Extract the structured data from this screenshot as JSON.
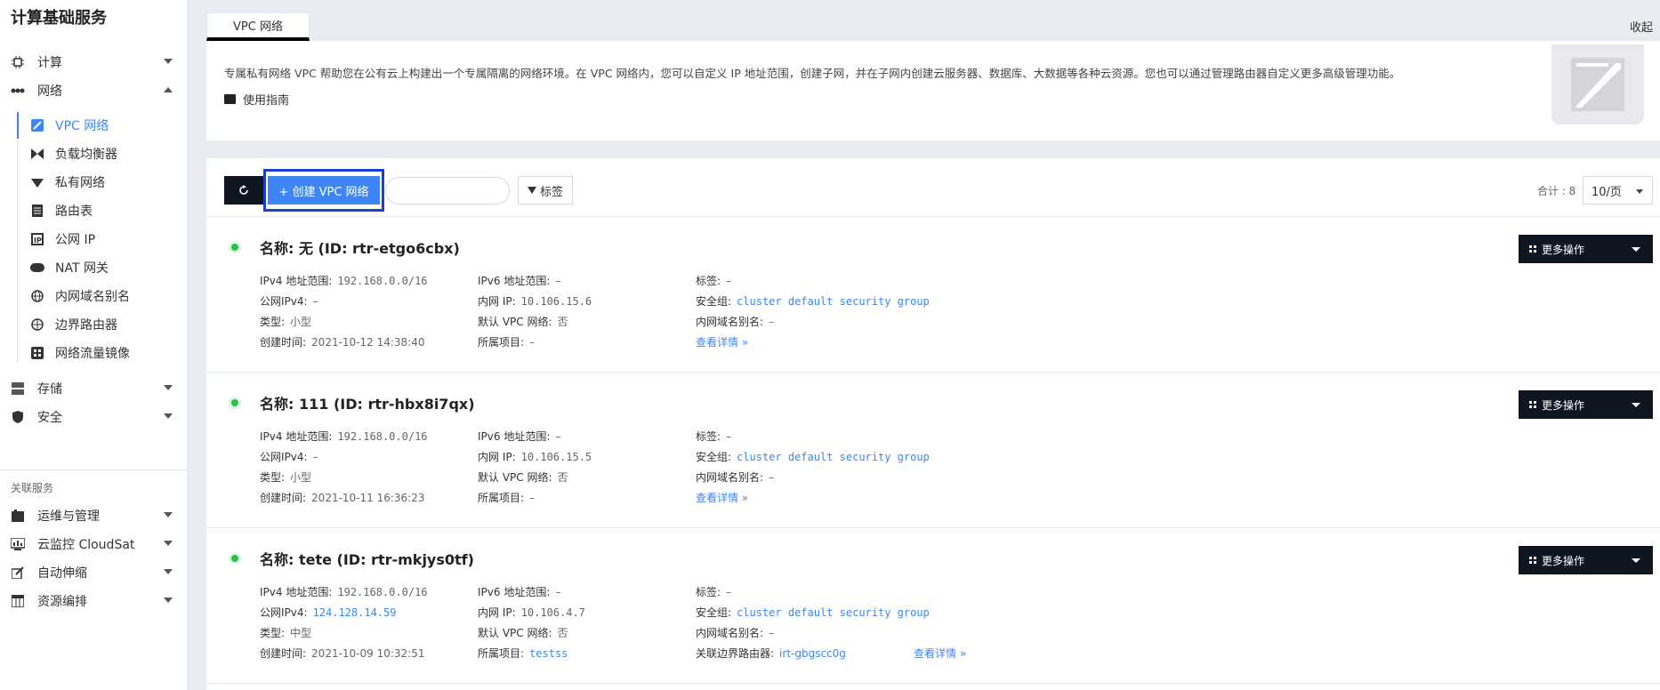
{
  "app_title": "计算基础服务",
  "sidebar": {
    "groups": [
      {
        "label": "计算"
      },
      {
        "label": "网络"
      }
    ],
    "network_items": [
      {
        "label": "VPC 网络"
      },
      {
        "label": "负载均衡器"
      },
      {
        "label": "私有网络"
      },
      {
        "label": "路由表"
      },
      {
        "label": "公网 IP"
      },
      {
        "label": "NAT 网关"
      },
      {
        "label": "内网域名别名"
      },
      {
        "label": "边界路由器"
      },
      {
        "label": "网络流量镜像"
      }
    ],
    "more_groups": [
      {
        "label": "存储"
      },
      {
        "label": "安全"
      }
    ],
    "related_label": "关联服务",
    "related": [
      {
        "label": "运维与管理"
      },
      {
        "label": "云监控 CloudSat"
      },
      {
        "label": "自动伸缩"
      },
      {
        "label": "资源编排"
      }
    ]
  },
  "tabs": {
    "active": "VPC 网络",
    "collapse": "收起"
  },
  "description": {
    "text": "专属私有网络 VPC 帮助您在公有云上构建出一个专属隔离的网络环境。在 VPC 网络内，您可以自定义 IP 地址范围，创建子网，并在子网内创建云服务器、数据库、大数据等各种云资源。您也可以通过管理路由器自定义更多高级管理功能。",
    "guide": "使用指南"
  },
  "toolbar": {
    "create_label": "+ 创建 VPC 网络",
    "tag_label": "标签",
    "total": "合计 : 8",
    "page_size": "10/页"
  },
  "labels": {
    "ipv4_range": "IPv4 地址范围:",
    "public_ipv4": "公网IPv4:",
    "type": "类型:",
    "created": "创建时间:",
    "ipv6_range": "IPv6 地址范围:",
    "private_ip": "内网 IP:",
    "default_vpc": "默认 VPC 网络:",
    "project": "所属项目:",
    "tags": "标签:",
    "security_group": "安全组:",
    "dns_alias": "内网域名别名:",
    "border_router": "关联边界路由器:",
    "detail": "查看详情 »",
    "more_ops": "更多操作"
  },
  "vpcs": [
    {
      "title": "名称: 无 (ID: rtr-etgo6cbx)",
      "ipv4_range": "192.168.0.0/16",
      "public_ipv4": "–",
      "type": "小型",
      "created": "2021-10-12 14:38:40",
      "ipv6_range": "–",
      "private_ip": "10.106.15.6",
      "default_vpc": "否",
      "project": "–",
      "tags": "–",
      "security_group": "cluster default security group",
      "dns_alias": "–"
    },
    {
      "title": "名称: 111 (ID: rtr-hbx8i7qx)",
      "ipv4_range": "192.168.0.0/16",
      "public_ipv4": "–",
      "type": "小型",
      "created": "2021-10-11 16:36:23",
      "ipv6_range": "–",
      "private_ip": "10.106.15.5",
      "default_vpc": "否",
      "project": "–",
      "tags": "–",
      "security_group": "cluster default security group",
      "dns_alias": "–"
    },
    {
      "title": "名称: tete (ID: rtr-mkjys0tf)",
      "ipv4_range": "192.168.0.0/16",
      "public_ipv4": "124.128.14.59",
      "type": "中型",
      "created": "2021-10-09 10:32:51",
      "ipv6_range": "–",
      "private_ip": "10.106.4.7",
      "default_vpc": "否",
      "project": "testss",
      "tags": "–",
      "security_group": "cluster default security group",
      "dns_alias": "–",
      "border_router": "irt-gbgscc0g"
    }
  ],
  "colors": {
    "accent": "#3e86f5",
    "dark": "#0f1621",
    "status_ok": "#27c24c",
    "highlight": "#1b3fd1"
  }
}
